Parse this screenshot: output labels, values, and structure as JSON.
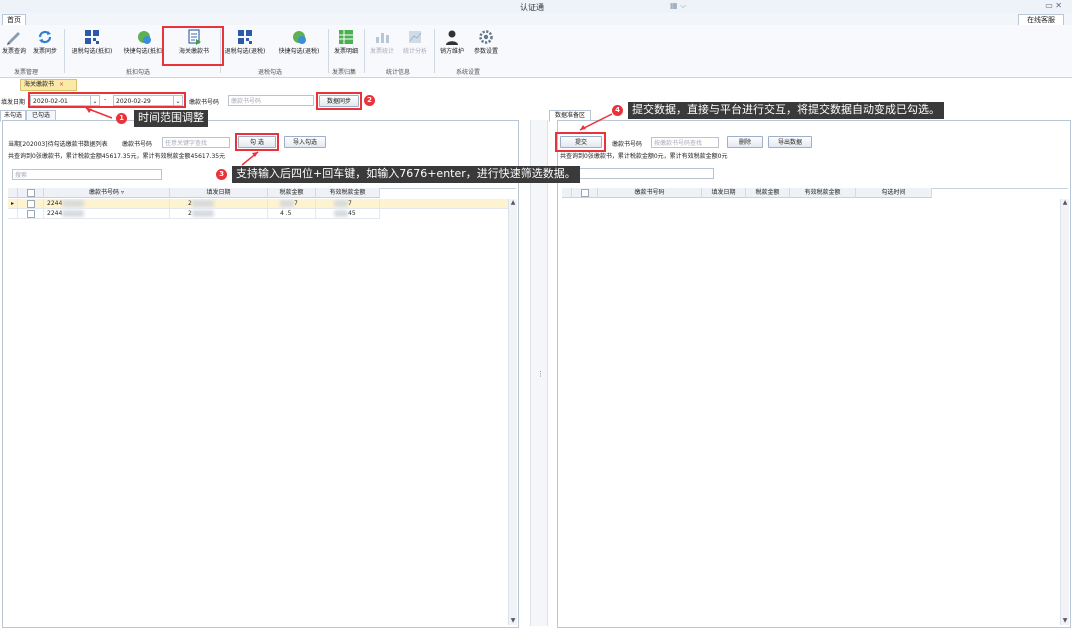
{
  "window": {
    "title": "认证通"
  },
  "tabs": {
    "home": "首页",
    "online_service": "在线客服"
  },
  "ribbon": {
    "buttons": [
      "发票查询",
      "发票同步",
      "退税勾选(抵扣)",
      "快捷勾选(抵扣)",
      "海关缴款书",
      "退税勾选(退税)",
      "快捷勾选(退税)",
      "发票明细",
      "发票统计",
      "统计分析",
      "销方维护",
      "参数设置"
    ],
    "groups": [
      "发票管理",
      "抵扣勾选",
      "退税勾选",
      "发票归集",
      "统计信息",
      "系统设置"
    ]
  },
  "doc_tab": "海关缴款书",
  "filter": {
    "date_label": "填发日期",
    "date_from": "2020-02-01",
    "date_to": "2020-02-29",
    "code_label": "缴款书号码",
    "code_placeholder": "缴款书号码",
    "sync_button": "数据同步"
  },
  "subtabs": {
    "unchecked": "未勾选",
    "checked": "已勾选"
  },
  "left": {
    "period_info": "当期[202003]待勾选缴款书数据列表",
    "code_label": "缴款书号码",
    "code_placeholder": "任意关键字查找",
    "select_button": "勾 选",
    "import_button": "导入勾选",
    "summary": "共查询到0张缴款书，累计税款金额45617.35元，累计有效税款金额45617.35元",
    "search_placeholder": "搜索",
    "columns": [
      "缴款书号码",
      "填发日期",
      "税款金额",
      "有效税款金额"
    ],
    "rows": [
      {
        "code": "2244",
        "date": "2",
        "tax": "7",
        "valid_tax": "7"
      },
      {
        "code": "2244",
        "date": "2",
        "tax": "4  .5",
        "valid_tax": "45"
      }
    ]
  },
  "right": {
    "tab": "数据准备区",
    "submit_button": "提交",
    "code_label": "缴款书号码",
    "code_placeholder": "按缴款书号码查找",
    "delete_button": "删除",
    "export_button": "导出数据",
    "summary": "共查询到0张缴款书，累计税款金额0元，累计有效税款金额0元",
    "columns": [
      "缴款书号码",
      "填发日期",
      "税款金额",
      "有效税款金额",
      "勾选时间"
    ]
  },
  "annotations": [
    {
      "num": "1",
      "text": "时间范围调整"
    },
    {
      "num": "2",
      "text": ""
    },
    {
      "num": "3",
      "text": "支持输入后四位+回车键，如输入7676+enter，进行快速筛选数据。"
    },
    {
      "num": "4",
      "text": "提交数据，直接与平台进行交互，将提交数据自动变成已勾选。"
    }
  ]
}
